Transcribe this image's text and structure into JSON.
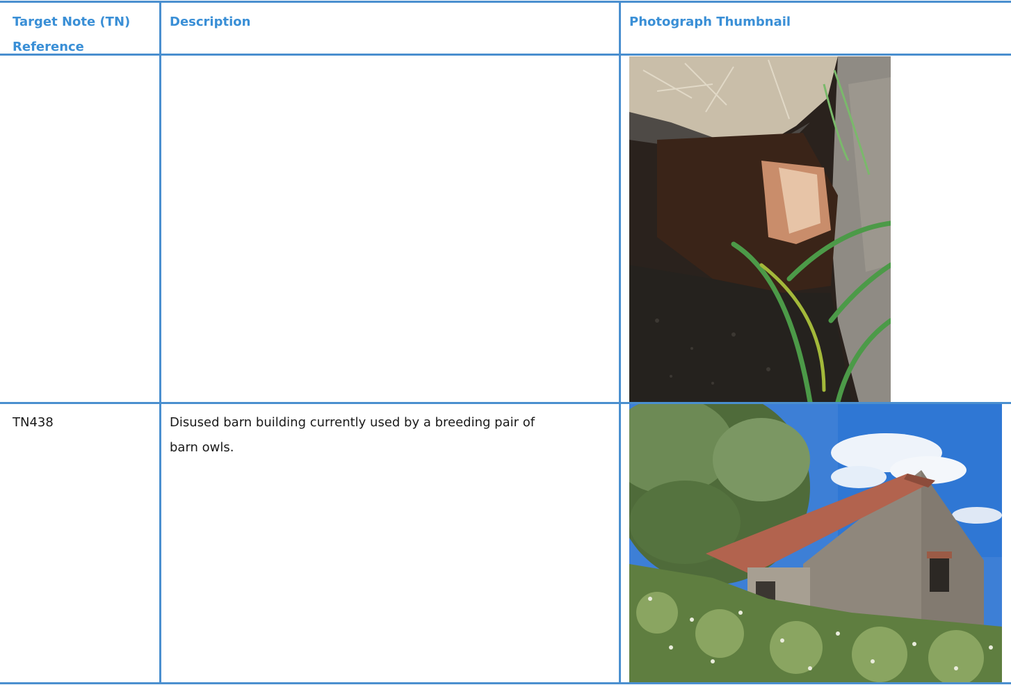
{
  "table": {
    "headers": {
      "ref": "Target Note (TN) Reference",
      "ref_line1": "Target Note (TN)",
      "ref_line2": "Reference",
      "description": "Description",
      "photo": "Photograph Thumbnail"
    },
    "rows": [
      {
        "ref": "",
        "description": "",
        "photo_icon": "burrow-photo"
      },
      {
        "ref": "TN438",
        "description": "Disused barn building currently used by a breeding pair of barn owls.",
        "description_line1": "Disused barn building currently used by a breeding pair of",
        "description_line2": "barn owls.",
        "photo_icon": "barn-photo"
      }
    ]
  },
  "colors": {
    "border": "#4a8fcf",
    "header_text": "#3a8fd6",
    "body_text": "#1a1a1a"
  }
}
